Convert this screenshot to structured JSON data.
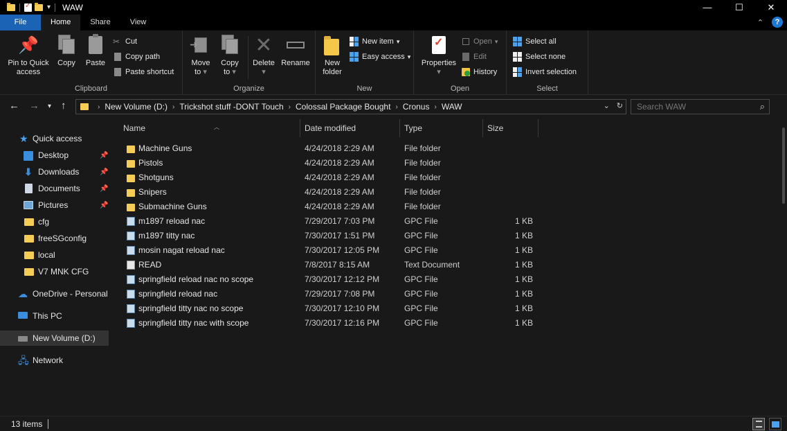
{
  "window": {
    "title": "WAW",
    "controls": {
      "minimize": "—",
      "maximize": "☐",
      "close": "✕"
    }
  },
  "ribbon_tabs": [
    {
      "label": "File"
    },
    {
      "label": "Home"
    },
    {
      "label": "Share"
    },
    {
      "label": "View"
    }
  ],
  "ribbon": {
    "clipboard": {
      "label": "Clipboard",
      "pin": "Pin to Quick access",
      "pin_line1": "Pin to Quick",
      "pin_line2": "access",
      "copy": "Copy",
      "paste": "Paste",
      "cut": "Cut",
      "copy_path": "Copy path",
      "paste_shortcut": "Paste shortcut"
    },
    "organize": {
      "label": "Organize",
      "move_to": "Move to",
      "move_line1": "Move",
      "move_line2": "to",
      "copy_to": "Copy to",
      "copy_line1": "Copy",
      "copy_line2": "to",
      "delete": "Delete",
      "rename": "Rename"
    },
    "new": {
      "label": "New",
      "new_folder_line1": "New",
      "new_folder_line2": "folder",
      "new_item": "New item",
      "easy_access": "Easy access"
    },
    "open": {
      "label": "Open",
      "properties": "Properties",
      "open": "Open",
      "edit": "Edit",
      "history": "History"
    },
    "select": {
      "label": "Select",
      "select_all": "Select all",
      "select_none": "Select none",
      "invert": "Invert selection"
    }
  },
  "address": {
    "crumbs": [
      "New Volume (D:)",
      "Trickshot stuff -DONT Touch",
      "Colossal Package Bought",
      "Cronus",
      "WAW"
    ],
    "search_placeholder": "Search WAW"
  },
  "nav_pane": [
    {
      "label": "Quick access",
      "icon": "star-icon"
    },
    {
      "label": "Desktop",
      "icon": "desktop-icon",
      "pinned": true
    },
    {
      "label": "Downloads",
      "icon": "download-icon",
      "pinned": true
    },
    {
      "label": "Documents",
      "icon": "documents-icon",
      "pinned": true
    },
    {
      "label": "Pictures",
      "icon": "pictures-icon",
      "pinned": true
    },
    {
      "label": "cfg",
      "icon": "folder-icon"
    },
    {
      "label": "freeSGconfig",
      "icon": "folder-icon"
    },
    {
      "label": "local",
      "icon": "folder-icon"
    },
    {
      "label": "V7 MNK CFG",
      "icon": "folder-icon"
    },
    {
      "label": "OneDrive - Personal",
      "icon": "cloud-icon"
    },
    {
      "label": "This PC",
      "icon": "computer-icon"
    },
    {
      "label": "New Volume (D:)",
      "icon": "drive-icon",
      "selected": true
    },
    {
      "label": "Network",
      "icon": "network-icon"
    }
  ],
  "columns": {
    "name": "Name",
    "date": "Date modified",
    "type": "Type",
    "size": "Size"
  },
  "files": [
    {
      "name": "Machine Guns",
      "date": "4/24/2018 2:29 AM",
      "type": "File folder",
      "size": "",
      "icon": "folder"
    },
    {
      "name": "Pistols",
      "date": "4/24/2018 2:29 AM",
      "type": "File folder",
      "size": "",
      "icon": "folder"
    },
    {
      "name": "Shotguns",
      "date": "4/24/2018 2:29 AM",
      "type": "File folder",
      "size": "",
      "icon": "folder"
    },
    {
      "name": "Snipers",
      "date": "4/24/2018 2:29 AM",
      "type": "File folder",
      "size": "",
      "icon": "folder"
    },
    {
      "name": "Submachine Guns",
      "date": "4/24/2018 2:29 AM",
      "type": "File folder",
      "size": "",
      "icon": "folder"
    },
    {
      "name": "m1897 reload nac",
      "date": "7/29/2017 7:03 PM",
      "type": "GPC File",
      "size": "1 KB",
      "icon": "gpc"
    },
    {
      "name": "m1897 titty nac",
      "date": "7/30/2017 1:51 PM",
      "type": "GPC File",
      "size": "1 KB",
      "icon": "gpc"
    },
    {
      "name": "mosin nagat reload nac",
      "date": "7/30/2017 12:05 PM",
      "type": "GPC File",
      "size": "1 KB",
      "icon": "gpc"
    },
    {
      "name": "READ",
      "date": "7/8/2017 8:15 AM",
      "type": "Text Document",
      "size": "1 KB",
      "icon": "text"
    },
    {
      "name": "springfield reload nac no scope",
      "date": "7/30/2017 12:12 PM",
      "type": "GPC File",
      "size": "1 KB",
      "icon": "gpc"
    },
    {
      "name": "springfield reload nac",
      "date": "7/29/2017 7:08 PM",
      "type": "GPC File",
      "size": "1 KB",
      "icon": "gpc"
    },
    {
      "name": "springfield titty nac no scope",
      "date": "7/30/2017 12:10 PM",
      "type": "GPC File",
      "size": "1 KB",
      "icon": "gpc"
    },
    {
      "name": "springfield titty nac with scope",
      "date": "7/30/2017 12:16 PM",
      "type": "GPC File",
      "size": "1 KB",
      "icon": "gpc"
    }
  ],
  "status": {
    "item_count": "13 items"
  }
}
